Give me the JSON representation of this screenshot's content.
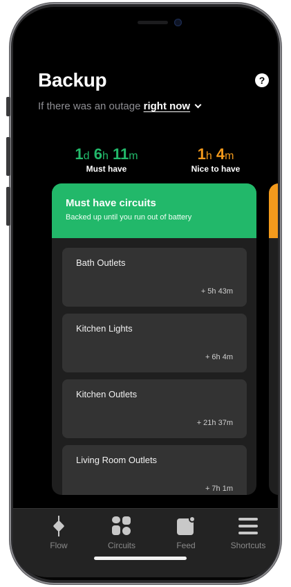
{
  "header": {
    "title": "Backup",
    "help": "?",
    "subtitle_prefix": "If there was an outage",
    "subtitle_selector": "right now"
  },
  "stats": {
    "must_have": {
      "d": "1",
      "d_unit": "d",
      "h": "6",
      "h_unit": "h",
      "m": "11",
      "m_unit": "m",
      "label": "Must have"
    },
    "nice_to_have": {
      "h": "1",
      "h_unit": "h",
      "m": "4",
      "m_unit": "m",
      "label": "Nice to have"
    }
  },
  "card": {
    "title": "Must have circuits",
    "subtitle": "Backed up until you run out of battery",
    "circuits": [
      {
        "name": "Bath Outlets",
        "time": "+ 5h 43m"
      },
      {
        "name": "Kitchen Lights",
        "time": "+ 6h 4m"
      },
      {
        "name": "Kitchen Outlets",
        "time": "+ 21h 37m"
      },
      {
        "name": "Living Room Outlets",
        "time": "+ 7h 1m"
      }
    ]
  },
  "tabs": [
    {
      "label": "Flow",
      "icon": "flow-icon"
    },
    {
      "label": "Circuits",
      "icon": "circuits-icon"
    },
    {
      "label": "Feed",
      "icon": "feed-icon"
    },
    {
      "label": "Shortcuts",
      "icon": "shortcuts-icon"
    }
  ],
  "colors": {
    "must_have_green": "#22b86a",
    "nice_to_have_orange": "#f39a1c",
    "background": "#000000",
    "card": "#1f1f1f",
    "circuit_tile": "#333333"
  }
}
